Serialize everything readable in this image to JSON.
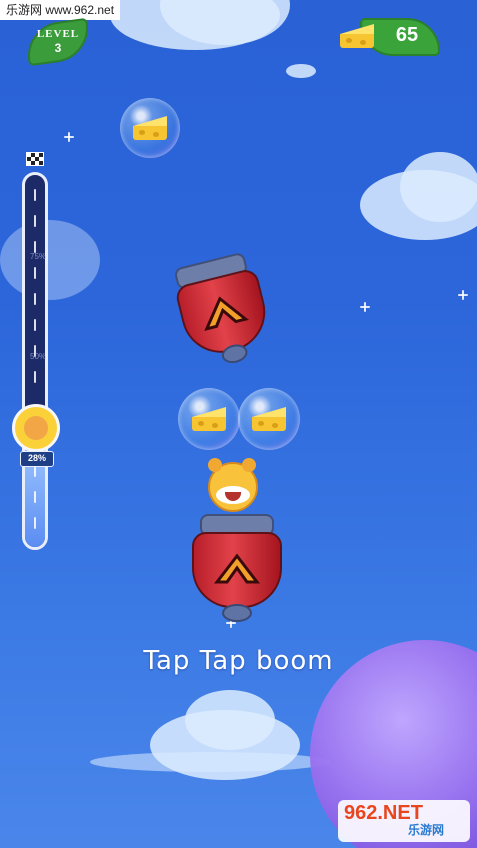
{
  "watermark_top": "乐游网 www.962.net",
  "level": {
    "title": "LEVEL",
    "number": "3"
  },
  "cheese_counter": {
    "value": "65",
    "icon": "cheese-icon"
  },
  "progress": {
    "percent_label": "28%",
    "fraction": 0.28,
    "marks": [
      "75%",
      "50%"
    ]
  },
  "subtitle": "Tap Tap boom",
  "watermark_bottom": {
    "main": "962.NET",
    "sub": "乐游网"
  },
  "colors": {
    "sky": "#2c66da",
    "leaf_green": "#3a9c3a",
    "cannon_red": "#d2313b",
    "cheese_yellow": "#f7c531"
  }
}
